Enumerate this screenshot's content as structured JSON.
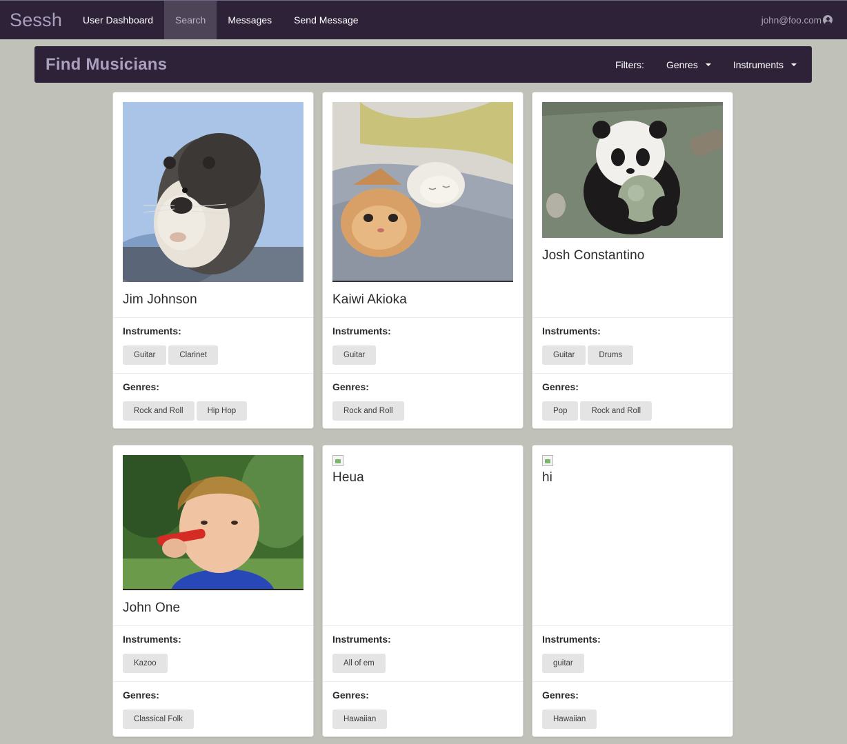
{
  "nav": {
    "brand": "Sessh",
    "items": [
      {
        "label": "User Dashboard"
      },
      {
        "label": "Search"
      },
      {
        "label": "Messages"
      },
      {
        "label": "Send Message"
      }
    ],
    "user_email": "john@foo.com"
  },
  "header": {
    "title": "Find Musicians",
    "filters_label": "Filters:",
    "genres_label": "Genres",
    "instruments_label": "Instruments"
  },
  "labels": {
    "instruments": "Instruments:",
    "genres": "Genres:"
  },
  "musicians": [
    {
      "name": "Jim Johnson",
      "photo": "muskrat",
      "instruments": [
        "Guitar",
        "Clarinet"
      ],
      "genres": [
        "Rock and Roll",
        "Hip Hop"
      ]
    },
    {
      "name": "Kaiwi Akioka",
      "photo": "cats",
      "instruments": [
        "Guitar"
      ],
      "genres": [
        "Rock and Roll"
      ]
    },
    {
      "name": "Josh Constantino",
      "photo": "panda",
      "instruments": [
        "Guitar",
        "Drums"
      ],
      "genres": [
        "Pop",
        "Rock and Roll"
      ]
    },
    {
      "name": "John One",
      "photo": "kazoo-kid",
      "instruments": [
        "Kazoo"
      ],
      "genres": [
        "Classical Folk"
      ]
    },
    {
      "name": "Heua",
      "photo": "broken-image",
      "instruments": [
        "All of em"
      ],
      "genres": [
        "Hawaiian"
      ]
    },
    {
      "name": "hi",
      "photo": "broken-image",
      "instruments": [
        "guitar"
      ],
      "genres": [
        "Hawaiian"
      ]
    }
  ],
  "colors": {
    "navbar": "#2e2239",
    "page_bg": "#c0c2b9",
    "brand_text": "#a9a0bd",
    "active_tab": "#4e4458",
    "tag_bg": "#e4e4e4"
  }
}
